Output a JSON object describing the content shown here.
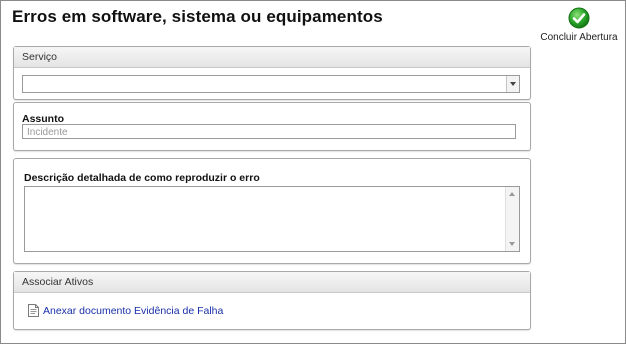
{
  "page": {
    "title": "Erros em software, sistema ou equipamentos"
  },
  "actions": {
    "finish_label": "Concluir Abertura",
    "finish_icon": "green-check-icon"
  },
  "service_panel": {
    "header": "Serviço",
    "selected_value": ""
  },
  "subject": {
    "label": "Assunto",
    "placeholder": "Incidente"
  },
  "description": {
    "label": "Descrição detalhada de como reproduzir o erro",
    "value": ""
  },
  "assets_panel": {
    "header": "Associar Ativos",
    "attach_link": "Anexar documento Evidência de Falha",
    "attach_icon": "document-icon"
  },
  "colors": {
    "accent_green": "#2aa52a",
    "link_blue": "#1a2fa8"
  }
}
